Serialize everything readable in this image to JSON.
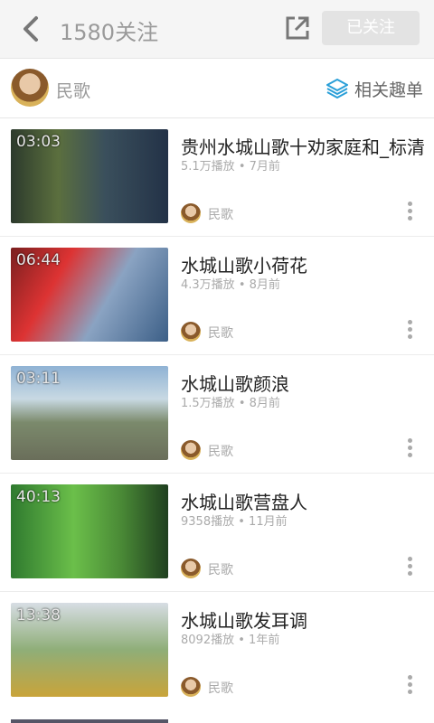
{
  "header": {
    "title": "1580关注",
    "follow_button": "已关注"
  },
  "channel": {
    "name": "民歌",
    "related_label": "相关趣单"
  },
  "videos": [
    {
      "duration": "03:03",
      "title": "贵州水城山歌十劝家庭和_标清",
      "plays": "5.1万播放",
      "sep": "•",
      "age": "7月前",
      "uploader": "民歌"
    },
    {
      "duration": "06:44",
      "title": "水城山歌小荷花",
      "plays": "4.3万播放",
      "sep": "•",
      "age": "8月前",
      "uploader": "民歌"
    },
    {
      "duration": "03:11",
      "title": "水城山歌颜浪",
      "plays": "1.5万播放",
      "sep": "•",
      "age": "8月前",
      "uploader": "民歌"
    },
    {
      "duration": "40:13",
      "title": "水城山歌营盘人",
      "plays": "9358播放",
      "sep": "•",
      "age": "11月前",
      "uploader": "民歌"
    },
    {
      "duration": "13:38",
      "title": "水城山歌发耳调",
      "plays": "8092播放",
      "sep": "•",
      "age": "1年前",
      "uploader": "民歌"
    }
  ],
  "icons": {
    "back": "chevron-left-icon",
    "share": "share-icon",
    "related": "layers-icon",
    "more": "more-vertical-icon"
  },
  "colors": {
    "accent": "#2a9fd8",
    "header_bg": "#f5f5f5",
    "follow_btn_bg": "#e3e3e3"
  }
}
